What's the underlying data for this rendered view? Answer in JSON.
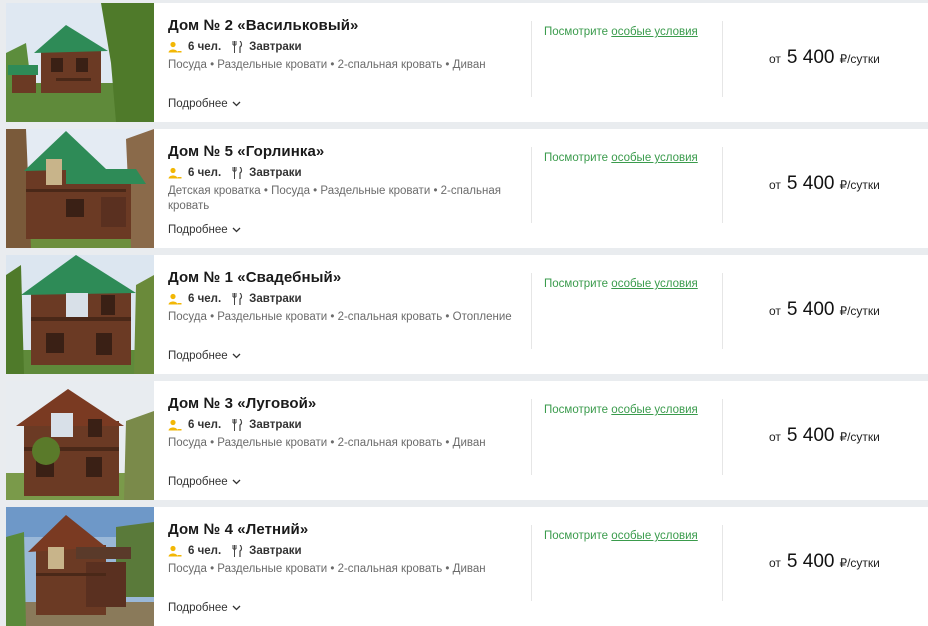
{
  "cards": [
    {
      "title": "Дом № 2 «Васильковый»",
      "guests": "6 чел.",
      "meal": "Завтраки",
      "amenities": "Посуда • Раздельные кровати • 2-спальная кровать • Диван",
      "more": "Подробнее",
      "cond_prefix": "Посмотрите",
      "cond_link": "особые условия",
      "price_prefix": "от",
      "price_value": "5 400",
      "price_unit": "₽/сутки"
    },
    {
      "title": "Дом № 5 «Горлинка»",
      "guests": "6 чел.",
      "meal": "Завтраки",
      "amenities": "Детская кроватка • Посуда • Раздельные кровати • 2-спальная кровать",
      "more": "Подробнее",
      "cond_prefix": "Посмотрите",
      "cond_link": "особые условия",
      "price_prefix": "от",
      "price_value": "5 400",
      "price_unit": "₽/сутки"
    },
    {
      "title": "Дом № 1 «Свадебный»",
      "guests": "6 чел.",
      "meal": "Завтраки",
      "amenities": "Посуда • Раздельные кровати • 2-спальная кровать • Отопление",
      "more": "Подробнее",
      "cond_prefix": "Посмотрите",
      "cond_link": "особые условия",
      "price_prefix": "от",
      "price_value": "5 400",
      "price_unit": "₽/сутки"
    },
    {
      "title": "Дом № 3 «Луговой»",
      "guests": "6 чел.",
      "meal": "Завтраки",
      "amenities": "Посуда • Раздельные кровати • 2-спальная кровать • Диван",
      "more": "Подробнее",
      "cond_prefix": "Посмотрите",
      "cond_link": "особые условия",
      "price_prefix": "от",
      "price_value": "5 400",
      "price_unit": "₽/сутки"
    },
    {
      "title": "Дом № 4 «Летний»",
      "guests": "6 чел.",
      "meal": "Завтраки",
      "amenities": "Посуда • Раздельные кровати • 2-спальная кровать • Диван",
      "more": "Подробнее",
      "cond_prefix": "Посмотрите",
      "cond_link": "особые условия",
      "price_prefix": "от",
      "price_value": "5 400",
      "price_unit": "₽/сутки"
    }
  ],
  "colors": {
    "accent_green": "#3a9b4c",
    "roof_green": "#2e8b57",
    "wood_brown": "#6b3a24",
    "guest_icon": "#f2b705"
  },
  "icons": {
    "guests": "person-icon",
    "meal": "fork-knife-icon",
    "more": "chevron-down-icon"
  }
}
